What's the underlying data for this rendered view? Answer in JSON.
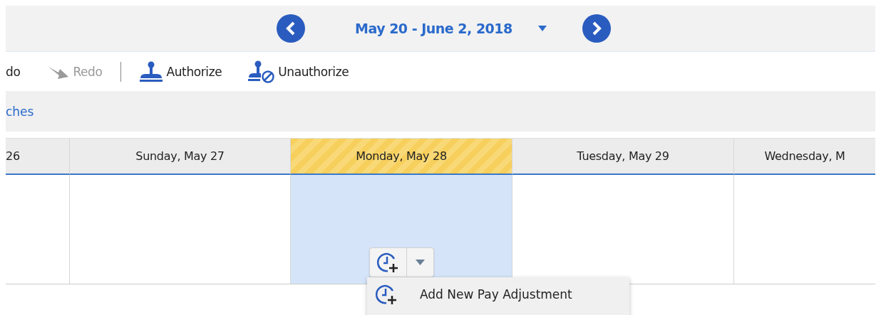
{
  "date_nav": {
    "range": "May 20 - June 2, 2018"
  },
  "toolbar": [
    {
      "kind": "undo",
      "label": "do",
      "disabled": false
    },
    {
      "kind": "redo",
      "label": "Redo",
      "disabled": true
    },
    {
      "kind": "authorize",
      "label": "Authorize",
      "disabled": false
    },
    {
      "kind": "unauthorize",
      "label": "Unauthorize",
      "disabled": false
    }
  ],
  "filter_bar": {
    "link": "ches"
  },
  "days": [
    {
      "label": "26",
      "selected": false
    },
    {
      "label": "Sunday, May 27",
      "selected": false
    },
    {
      "label": "Monday, May 28",
      "selected": true
    },
    {
      "label": "Tuesday, May 29",
      "selected": false
    },
    {
      "label": "Wednesday, M",
      "selected": false
    }
  ],
  "add_menu": {
    "items": [
      {
        "label": "Add New Pay Adjustment"
      }
    ]
  }
}
